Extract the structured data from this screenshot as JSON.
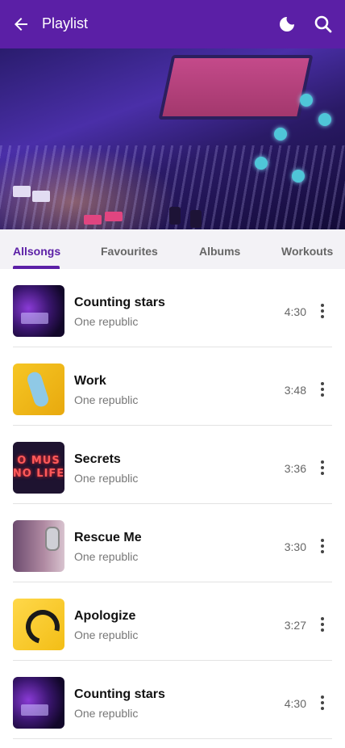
{
  "appbar": {
    "title": "Playlist",
    "background": "#5b1fa6",
    "icons": [
      "back-arrow-icon",
      "moon-icon",
      "search-icon"
    ]
  },
  "tabs": [
    {
      "label": "Allsongs",
      "active": true
    },
    {
      "label": "Favourites",
      "active": false
    },
    {
      "label": "Albums",
      "active": false
    },
    {
      "label": "Workouts",
      "active": false
    }
  ],
  "songs": [
    {
      "title": "Counting stars",
      "artist": "One republic",
      "duration": "4:30"
    },
    {
      "title": "Work",
      "artist": "One republic",
      "duration": "3:48"
    },
    {
      "title": "Secrets",
      "artist": "One republic",
      "duration": "3:36"
    },
    {
      "title": "Rescue Me",
      "artist": "One republic",
      "duration": "3:30"
    },
    {
      "title": "Apologize",
      "artist": "One republic",
      "duration": "3:27"
    },
    {
      "title": "Counting stars",
      "artist": "One republic",
      "duration": "4:30"
    }
  ],
  "thumbs": {
    "neon_line1": "O MUS",
    "neon_line2": "NO LIFE"
  },
  "colors": {
    "accent": "#5b1fa6",
    "tab_bar": "#f3f2f6"
  }
}
